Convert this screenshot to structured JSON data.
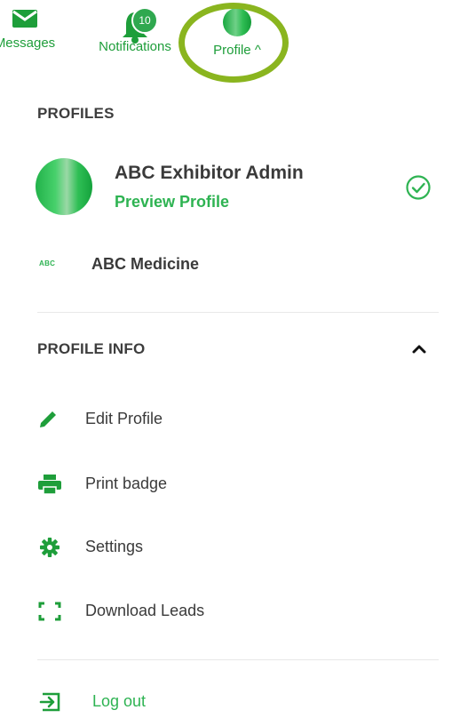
{
  "topnav": {
    "messages": "Messages",
    "notifications": "Notifications",
    "notifications_count": "10",
    "profile": "Profile"
  },
  "profiles": {
    "heading": "PROFILES",
    "active": {
      "name": "ABC Exhibitor Admin",
      "link": "Preview Profile"
    },
    "other": {
      "logo_text": "ABC",
      "name": "ABC Medicine"
    }
  },
  "profile_info": {
    "heading": "PROFILE INFO",
    "items": [
      {
        "label": "Edit Profile",
        "icon": "pencil-icon"
      },
      {
        "label": "Print badge",
        "icon": "printer-icon"
      },
      {
        "label": "Settings",
        "icon": "gear-icon"
      },
      {
        "label": "Download Leads",
        "icon": "frame-corners-icon"
      }
    ]
  },
  "logout": {
    "label": "Log out",
    "icon": "logout-icon"
  },
  "colors": {
    "accent": "#2eb352",
    "highlight": "#8ab51f"
  }
}
